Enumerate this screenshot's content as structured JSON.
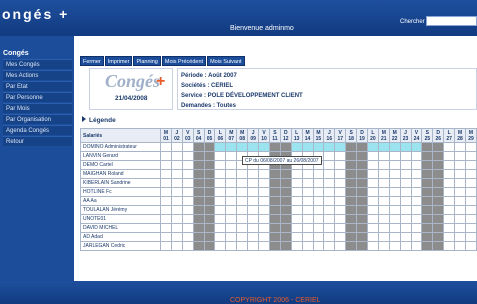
{
  "app": {
    "brand": "ongés +",
    "welcome": "Bienvenue adminmo",
    "search_label": "Chercher :",
    "search_value": ""
  },
  "sidebar": {
    "title": "Congés",
    "items": [
      {
        "label": "Mes Congés"
      },
      {
        "label": "Mes Actions"
      },
      {
        "label": "Par Etat"
      },
      {
        "label": "Par Personne"
      },
      {
        "label": "Par Mois"
      },
      {
        "label": "Par Organisation"
      },
      {
        "label": "Agenda Congés"
      },
      {
        "label": "Retour"
      }
    ]
  },
  "toolbar": {
    "buttons": [
      "Fermer",
      "Imprimer",
      "Planning",
      "Mois Précédent",
      "Mois Suivant"
    ]
  },
  "logo": {
    "text": "Congés",
    "plus": "+",
    "date": "21/04/2008"
  },
  "meta": {
    "periode": "Période : Août 2007",
    "societe": "Sociétés : CERIEL",
    "service": "Service : POLE DÉVELOPPEMENT CLIENT",
    "demandes": "Demandes : Toutes"
  },
  "legend_label": "Légende",
  "grid": {
    "name_header": "Salariés",
    "days": [
      {
        "d": "M",
        "n": "01"
      },
      {
        "d": "J",
        "n": "02"
      },
      {
        "d": "V",
        "n": "03"
      },
      {
        "d": "S",
        "n": "04"
      },
      {
        "d": "D",
        "n": "05"
      },
      {
        "d": "L",
        "n": "06"
      },
      {
        "d": "M",
        "n": "07"
      },
      {
        "d": "M",
        "n": "08"
      },
      {
        "d": "J",
        "n": "09"
      },
      {
        "d": "V",
        "n": "10"
      },
      {
        "d": "S",
        "n": "11"
      },
      {
        "d": "D",
        "n": "12"
      },
      {
        "d": "L",
        "n": "13"
      },
      {
        "d": "M",
        "n": "14"
      },
      {
        "d": "M",
        "n": "15"
      },
      {
        "d": "J",
        "n": "16"
      },
      {
        "d": "V",
        "n": "17"
      },
      {
        "d": "S",
        "n": "18"
      },
      {
        "d": "D",
        "n": "19"
      },
      {
        "d": "L",
        "n": "20"
      },
      {
        "d": "M",
        "n": "21"
      },
      {
        "d": "M",
        "n": "22"
      },
      {
        "d": "J",
        "n": "23"
      },
      {
        "d": "V",
        "n": "24"
      },
      {
        "d": "S",
        "n": "25"
      },
      {
        "d": "D",
        "n": "26"
      },
      {
        "d": "L",
        "n": "27"
      },
      {
        "d": "M",
        "n": "28"
      },
      {
        "d": "M",
        "n": "29"
      }
    ],
    "weekend_days": [
      "04",
      "05",
      "11",
      "12",
      "18",
      "19",
      "25",
      "26"
    ],
    "rows": [
      {
        "name": "DOMINO Administrateur",
        "cp_from": 6,
        "cp_to": 26
      },
      {
        "name": "LANVIN Gerard",
        "cp_from": 0,
        "cp_to": 0
      },
      {
        "name": "DEMO Cartel",
        "cp_from": 0,
        "cp_to": 0
      },
      {
        "name": "MAIGHAN Roland",
        "cp_from": 0,
        "cp_to": 0
      },
      {
        "name": "KIBERLAIN Sandrine",
        "cp_from": 0,
        "cp_to": 0
      },
      {
        "name": "HOTLINE Fc",
        "cp_from": 0,
        "cp_to": 0
      },
      {
        "name": "AA Aa",
        "cp_from": 0,
        "cp_to": 0
      },
      {
        "name": "TOULALAN Jérémy",
        "cp_from": 0,
        "cp_to": 0
      },
      {
        "name": "UNOTE01",
        "cp_from": 0,
        "cp_to": 0
      },
      {
        "name": "DAVID MICHEL",
        "cp_from": 0,
        "cp_to": 0
      },
      {
        "name": "AD Adad",
        "cp_from": 0,
        "cp_to": 0
      },
      {
        "name": "JARLEGAN Cedric",
        "cp_from": 0,
        "cp_to": 0
      }
    ],
    "tooltip": "CP du 06/08/2007 au 26/08/2007"
  },
  "footer": {
    "copyright": "COPYRIGHT 2006 - CERIEL"
  },
  "colors": {
    "header": "#1c4d9b",
    "cp": "#9be4ef",
    "weekend": "#8c8c8c",
    "accent": "#e85b2a"
  }
}
